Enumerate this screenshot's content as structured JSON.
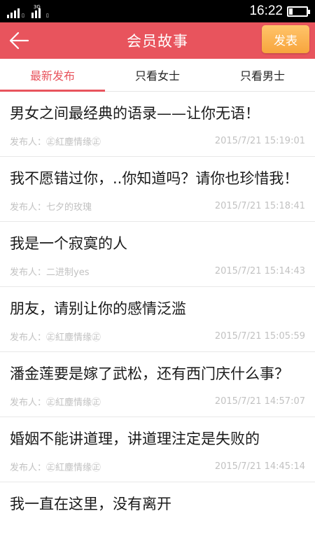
{
  "status_bar": {
    "network": "3G",
    "time": "16:22"
  },
  "header": {
    "title": "会员故事",
    "publish_label": "发表",
    "accent_color": "#e8545d"
  },
  "tabs": [
    {
      "label": "最新发布",
      "active": true
    },
    {
      "label": "只看女士",
      "active": false
    },
    {
      "label": "只看男士",
      "active": false
    }
  ],
  "posts": {
    "author_prefix": "发布人：",
    "items": [
      {
        "title": "男女之间最经典的语录——让你无语！",
        "author": "㊣紅塵情缘㊣",
        "time": "2015/7/21 15:19:01"
      },
      {
        "title": "我不愿错过你，..你知道吗？请你也珍惜我！",
        "author": "七夕的玫瑰",
        "time": "2015/7/21 15:18:41"
      },
      {
        "title": "我是一个寂寞的人",
        "author": "二进制yes",
        "time": "2015/7/21 15:14:43"
      },
      {
        "title": "朋友，请别让你的感情泛滥",
        "author": "㊣紅塵情缘㊣",
        "time": "2015/7/21 15:05:59"
      },
      {
        "title": "潘金莲要是嫁了武松，还有西门庆什么事？",
        "author": "㊣紅塵情缘㊣",
        "time": "2015/7/21 14:57:07"
      },
      {
        "title": "婚姻不能讲道理，讲道理注定是失败的",
        "author": "㊣紅塵情缘㊣",
        "time": "2015/7/21 14:45:14"
      },
      {
        "title": "我一直在这里，没有离开",
        "author": "",
        "time": ""
      }
    ]
  }
}
